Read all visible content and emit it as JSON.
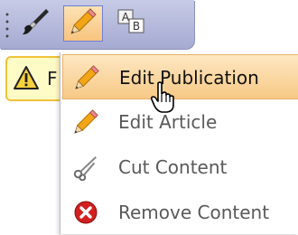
{
  "toolbar": {
    "buttons": [
      {
        "icon": "brush-icon"
      },
      {
        "icon": "pencil-icon",
        "active": true
      },
      {
        "icon": "text-replace-icon"
      }
    ]
  },
  "warning": {
    "text": "F",
    "icon": "warning-icon"
  },
  "menu": {
    "items": [
      {
        "label": "Edit Publication",
        "icon": "pencil-icon",
        "highlighted": true
      },
      {
        "label": "Edit Article",
        "icon": "pencil-icon"
      },
      {
        "label": "Cut Content",
        "icon": "scissors-icon"
      },
      {
        "label": "Remove Content",
        "icon": "remove-icon"
      }
    ]
  },
  "colors": {
    "highlight": "#f7c985",
    "toolbar": "#a5aad2",
    "remove": "#d21f1f"
  }
}
